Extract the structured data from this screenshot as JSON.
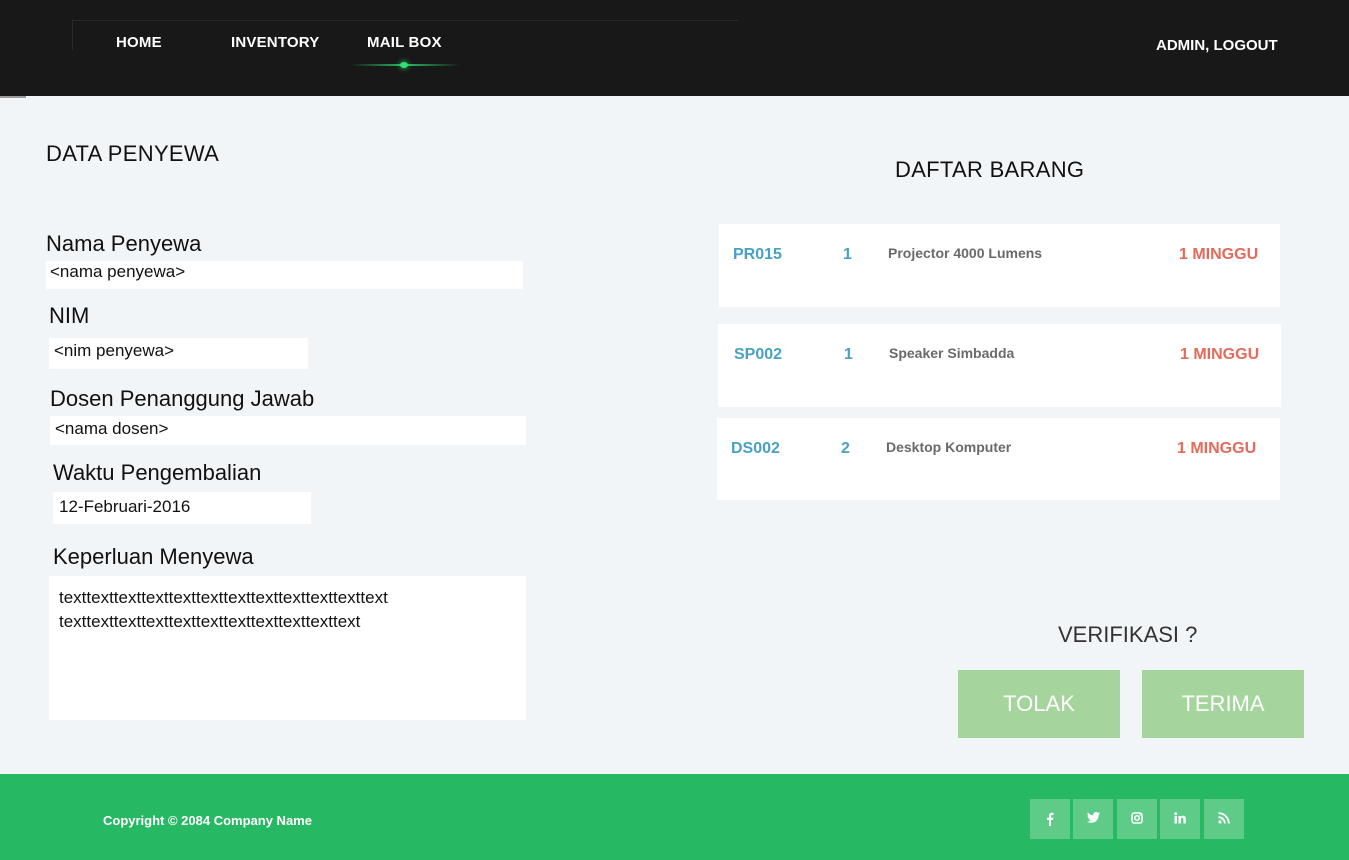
{
  "nav": {
    "home": "HOME",
    "inventory": "INVENTORY",
    "mailbox": "MAIL BOX",
    "user": "ADMIN, LOGOUT"
  },
  "form": {
    "title": "DATA PENYEWA",
    "nama_label": "Nama Penyewa",
    "nama_value": "<nama penyewa>",
    "nim_label": "NIM",
    "nim_value": "<nim penyewa>",
    "dosen_label": "Dosen Penanggung Jawab",
    "dosen_value": "<nama dosen>",
    "waktu_label": "Waktu Pengembalian",
    "waktu_value": "12-Februari-2016",
    "keperluan_label": "Keperluan Menyewa",
    "keperluan_line1": "texttexttexttexttexttexttexttexttexttexttexttext",
    "keperluan_line2": "texttexttexttexttexttexttexttexttexttexttext"
  },
  "items": {
    "title": "DAFTAR BARANG",
    "list": [
      {
        "code": "PR015",
        "qty": "1",
        "name": "Projector 4000 Lumens",
        "duration": "1 MINGGU"
      },
      {
        "code": "SP002",
        "qty": "1",
        "name": "Speaker Simbadda",
        "duration": "1 MINGGU"
      },
      {
        "code": "DS002",
        "qty": "2",
        "name": "Desktop Komputer",
        "duration": "1 MINGGU"
      }
    ]
  },
  "verification": {
    "label": "VERIFIKASI ?",
    "reject": "TOLAK",
    "accept": "TERIMA"
  },
  "footer": {
    "copyright": "Copyright © 2084 Company Name",
    "social_icons": [
      "facebook-icon",
      "twitter-icon",
      "instagram-icon",
      "linkedin-icon",
      "rss-icon"
    ]
  },
  "colors": {
    "header_bg": "#181818",
    "page_bg": "#f1f5f8",
    "footer_bg": "#27b864",
    "button_bg": "#a5d59d",
    "code_color": "#4aa0c4",
    "duration_color": "#e46a5a"
  }
}
